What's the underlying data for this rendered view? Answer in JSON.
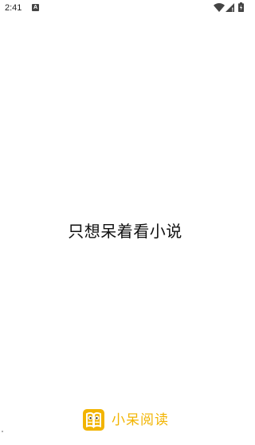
{
  "status_bar": {
    "time": "2:41",
    "notification_icon_letter": "A",
    "icons": [
      "wifi-icon",
      "signal-icon",
      "battery-icon"
    ]
  },
  "splash": {
    "slogan": "只想呆着看小说"
  },
  "brand": {
    "name": "小呆阅读",
    "logo_icon": "book-logo-icon",
    "accent_color": "#F2B400"
  }
}
